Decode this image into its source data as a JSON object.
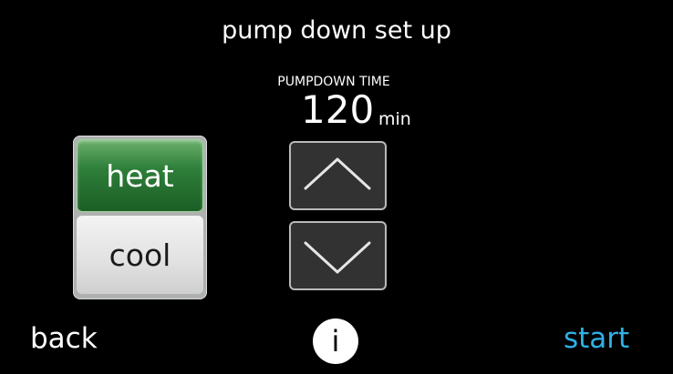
{
  "screen": {
    "title": "pump down set up"
  },
  "setting": {
    "label": "PUMPDOWN TIME",
    "value": "120",
    "unit": "min"
  },
  "mode": {
    "heat_label": "heat",
    "cool_label": "cool",
    "selected": "heat"
  },
  "controls": {
    "up_icon": "chevron-up-icon",
    "down_icon": "chevron-down-icon"
  },
  "footer": {
    "back_label": "back",
    "info_label": "i",
    "start_label": "start"
  },
  "colors": {
    "background": "#000000",
    "selected_green": "#2e7f3a",
    "start_blue": "#30b0e6"
  }
}
